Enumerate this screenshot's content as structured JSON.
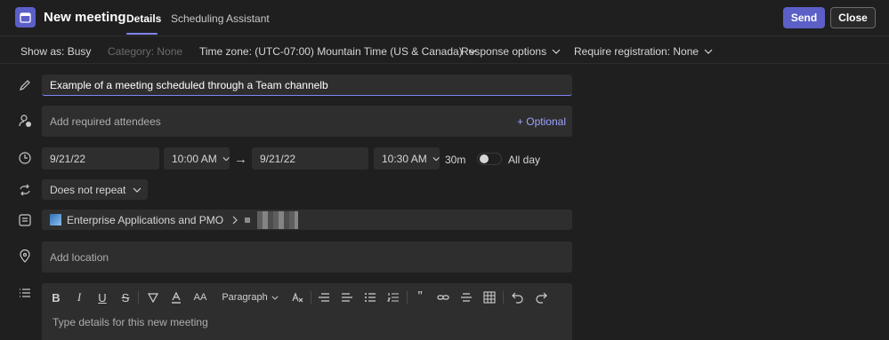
{
  "header": {
    "title": "New meeting",
    "tabs": [
      {
        "label": "Details",
        "active": true
      },
      {
        "label": "Scheduling Assistant",
        "active": false
      }
    ],
    "send_label": "Send",
    "close_label": "Close"
  },
  "options": {
    "show_as": "Show as: Busy",
    "category": "Category: None",
    "time_zone": "Time zone:  (UTC-07:00) Mountain Time (US & Canada)",
    "response_options": "Response options",
    "registration": "Require registration: None"
  },
  "form": {
    "title_value": "Example of a meeting scheduled through a Team channelb",
    "attendees_placeholder": "Add required attendees",
    "optional_label": "+ Optional",
    "start_date": "9/21/22",
    "start_time": "10:00 AM",
    "end_date": "9/21/22",
    "end_time": "10:30 AM",
    "duration": "30m",
    "all_day_label": "All day",
    "all_day_on": false,
    "repeat_value": "Does not repeat",
    "channel_label": "Enterprise Applications and PMO",
    "location_placeholder": "Add location",
    "details_placeholder": "Type details for this new meeting"
  },
  "toolbar": {
    "paragraph_label": "Paragraph"
  },
  "colors": {
    "accent": "#5b5fc7",
    "background": "#1f1f1f",
    "field": "#2e2e2e"
  }
}
